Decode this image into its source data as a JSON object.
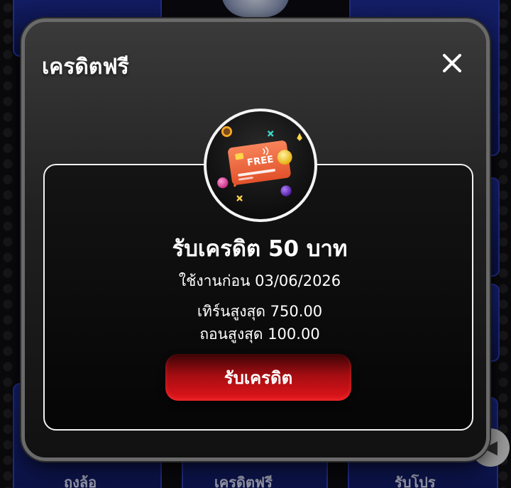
{
  "background": {
    "bottom_labels": [
      "ถุงล้อ",
      "เครดิตฟรี",
      "รับโปร"
    ]
  },
  "modal": {
    "title": "เครดิตฟรี",
    "close_icon": "close-icon"
  },
  "offer": {
    "badge_icon": "free-credit-card-icon",
    "badge_text": "FREE",
    "title": "รับเครดิต 50 บาท",
    "expiry": "ใช้งานก่อน 03/06/2026",
    "max_turnover": "เทิร์นสูงสุด 750.00",
    "max_withdraw": "ถอนสูงสุด 100.00",
    "claim_label": "รับเครดิต"
  },
  "colors": {
    "accent_red": "#e3151b",
    "card_orange": "#f26a3d",
    "bg_blue": "#1b2a8c"
  }
}
